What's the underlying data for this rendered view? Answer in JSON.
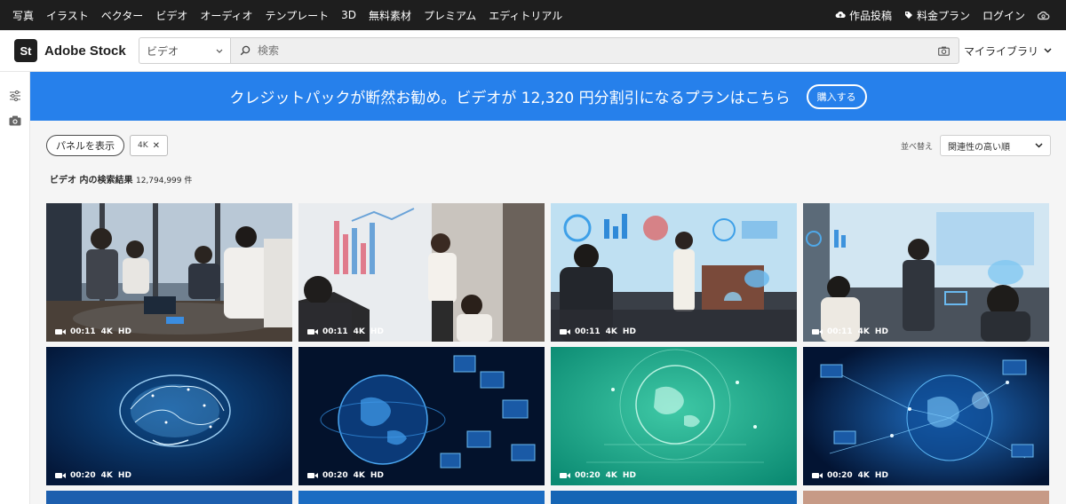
{
  "topnav": {
    "left": [
      "写真",
      "イラスト",
      "ベクター",
      "ビデオ",
      "オーディオ",
      "テンプレート",
      "3D",
      "無料素材",
      "プレミアム",
      "エディトリアル"
    ],
    "right": {
      "contribute": "作品投稿",
      "pricing": "料金プラン",
      "login": "ログイン",
      "icon": "creative-cloud-icon"
    }
  },
  "header": {
    "logo_text": "St",
    "brand": "Adobe Stock",
    "type_select": "ビデオ",
    "search_placeholder": "検索",
    "library": "マイライブラリ"
  },
  "rail": {
    "icons": [
      "filters-icon",
      "camera-icon"
    ]
  },
  "banner": {
    "text": "クレジットパックが断然お勧め。ビデオが 12,320 円分割引になるプランはこちら",
    "button": "購入する",
    "color": "#2680eb"
  },
  "filters": {
    "panel_button": "パネルを表示",
    "chip": "4K",
    "sort_label": "並べ替え",
    "sort_value": "関連性の高い順"
  },
  "results": {
    "label": "ビデオ 内の検索結果",
    "count": "12,794,999 件"
  },
  "tiles": [
    {
      "duration": "00:11",
      "res": "4K",
      "quality": "HD",
      "theme": "meeting"
    },
    {
      "duration": "00:11",
      "res": "4K",
      "quality": "HD",
      "theme": "presentation"
    },
    {
      "duration": "00:11",
      "res": "4K",
      "quality": "HD",
      "theme": "tech-presentation"
    },
    {
      "duration": "00:11",
      "res": "4K",
      "quality": "HD",
      "theme": "tech-office"
    },
    {
      "duration": "00:20",
      "res": "4K",
      "quality": "HD",
      "theme": "brain"
    },
    {
      "duration": "00:20",
      "res": "4K",
      "quality": "HD",
      "theme": "globe-network"
    },
    {
      "duration": "00:20",
      "res": "4K",
      "quality": "HD",
      "theme": "green-globe"
    },
    {
      "duration": "00:20",
      "res": "4K",
      "quality": "HD",
      "theme": "network-sphere"
    }
  ]
}
